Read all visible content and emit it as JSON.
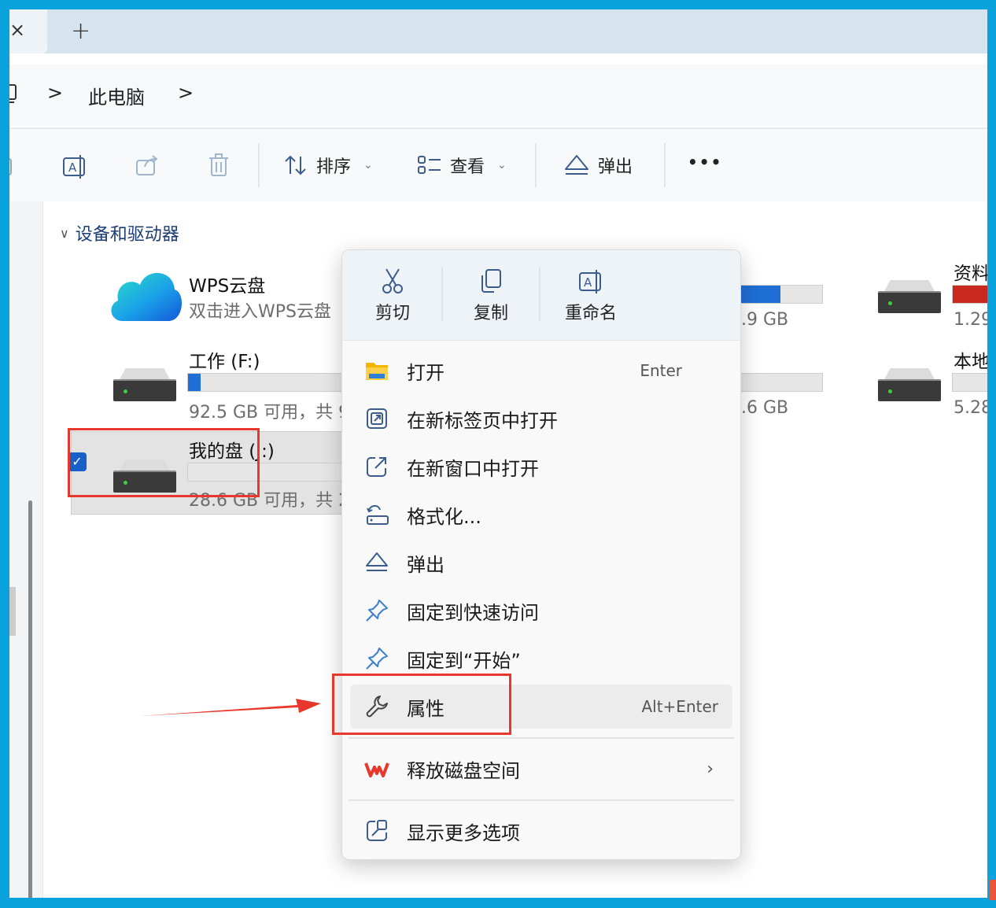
{
  "tabs": {
    "close_icon": "×",
    "new_tab_icon": "+"
  },
  "address": {
    "sep1": ">",
    "current": "此电脑",
    "sep2": ">"
  },
  "toolbar": {
    "sort_label": "排序",
    "view_label": "查看",
    "eject_label": "弹出",
    "more_label": "•••"
  },
  "section": {
    "title": "设备和驱动器"
  },
  "drives": [
    {
      "name": "WPS云盘",
      "sub": "双击进入WPS云盘"
    },
    {
      "name": "工作 (F:)",
      "sub": "92.5 GB 可用，共 9",
      "usage": 0.08
    },
    {
      "name": "我的盘 (J:)",
      "sub": "28.6 GB 可用，共 2",
      "usage": 0.0
    },
    {
      "partial_sub": ".9 GB",
      "usage": 0.6
    },
    {
      "partial_sub": ".6 GB",
      "usage": 0.0
    },
    {
      "name": "资料",
      "sub": "1.29",
      "usage": 0.9,
      "color": "#c9281e"
    },
    {
      "name": "本地",
      "sub": "5.28",
      "usage": 0.0
    }
  ],
  "context_menu": {
    "top": [
      {
        "label": "剪切",
        "icon": "scissors-icon"
      },
      {
        "label": "复制",
        "icon": "copy-icon"
      },
      {
        "label": "重命名",
        "icon": "rename-icon"
      }
    ],
    "items": [
      {
        "label": "打开",
        "shortcut": "Enter",
        "icon": "folder-icon"
      },
      {
        "label": "在新标签页中打开",
        "icon": "new-tab-icon"
      },
      {
        "label": "在新窗口中打开",
        "icon": "new-window-icon"
      },
      {
        "label": "格式化...",
        "icon": "format-icon"
      },
      {
        "label": "弹出",
        "icon": "eject-icon"
      },
      {
        "label": "固定到快速访问",
        "icon": "pin-icon"
      },
      {
        "label": "固定到“开始”",
        "icon": "pin-icon"
      },
      {
        "label": "属性",
        "shortcut": "Alt+Enter",
        "icon": "wrench-icon"
      },
      {
        "label": "释放磁盘空间",
        "icon": "wps-icon"
      },
      {
        "label": "显示更多选项",
        "icon": "more-options-icon"
      }
    ]
  },
  "colors": {
    "accent": "#1f6fd6",
    "annotation_red": "#e8372c",
    "frame": "#0aa2dc"
  }
}
